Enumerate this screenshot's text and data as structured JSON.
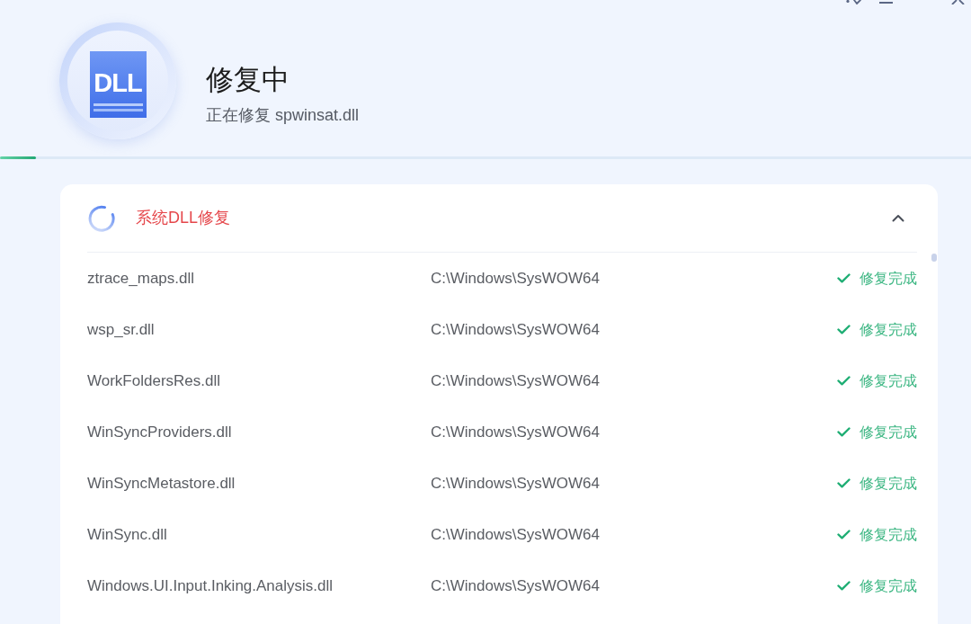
{
  "header": {
    "logo_text": "DLL",
    "title": "修复中",
    "subtitle": "正在修复 spwinsat.dll"
  },
  "progress": {
    "level": 0.037
  },
  "section": {
    "title": "系统DLL修复",
    "in_progress": true,
    "expanded": true
  },
  "rows": [
    {
      "name": "ztrace_maps.dll",
      "path": "C:\\Windows\\SysWOW64",
      "status": "修复完成",
      "done": true
    },
    {
      "name": "wsp_sr.dll",
      "path": "C:\\Windows\\SysWOW64",
      "status": "修复完成",
      "done": true
    },
    {
      "name": "WorkFoldersRes.dll",
      "path": "C:\\Windows\\SysWOW64",
      "status": "修复完成",
      "done": true
    },
    {
      "name": "WinSyncProviders.dll",
      "path": "C:\\Windows\\SysWOW64",
      "status": "修复完成",
      "done": true
    },
    {
      "name": "WinSyncMetastore.dll",
      "path": "C:\\Windows\\SysWOW64",
      "status": "修复完成",
      "done": true
    },
    {
      "name": "WinSync.dll",
      "path": "C:\\Windows\\SysWOW64",
      "status": "修复完成",
      "done": true
    },
    {
      "name": "Windows.UI.Input.Inking.Analysis.dll",
      "path": "C:\\Windows\\SysWOW64",
      "status": "修复完成",
      "done": true
    }
  ]
}
